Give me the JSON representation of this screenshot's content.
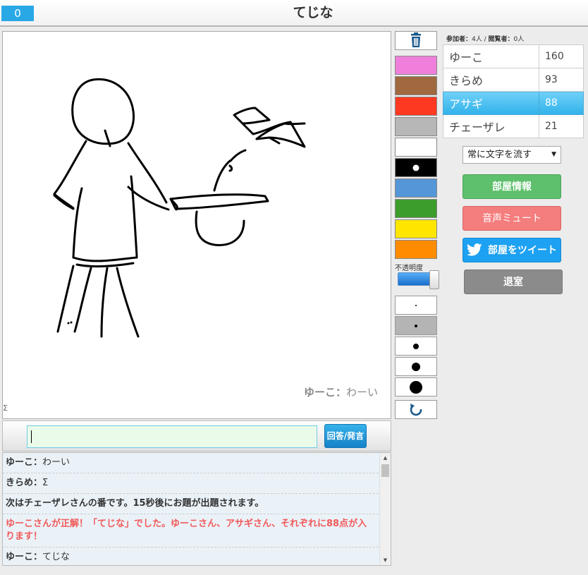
{
  "header": {
    "timer": "0",
    "title": "てじな"
  },
  "canvas": {
    "speech_name": "ゆーこ",
    "speech_sep": "：",
    "speech_text": "わーい",
    "sigma": "Σ"
  },
  "toolbar": {
    "colors": [
      "#f07fdb",
      "#a0693f",
      "#fe3921",
      "#b7b7b7",
      "#ffffff",
      "#000000",
      "#5596d8",
      "#3c9c2c",
      "#ffe600",
      "#ff8b00"
    ],
    "opacity_label": "不透明度",
    "opacity_value": 0.95,
    "brush_sizes": [
      2,
      4,
      8,
      12,
      18
    ],
    "selected_color_index": 5,
    "selected_brush_index": 1
  },
  "participants": {
    "label_participants": "参加者：",
    "participants_count": "4人",
    "sep": " / ",
    "label_viewers": "閲覧者：",
    "viewers_count": "0人"
  },
  "scores": [
    {
      "name": "ゆーこ",
      "points": "160"
    },
    {
      "name": "きらめ",
      "points": "93"
    },
    {
      "name": "アサギ",
      "points": "88"
    },
    {
      "name": "チェーザレ",
      "points": "21"
    }
  ],
  "controls": {
    "scroll_mode": "常に文字を流す",
    "room_info": "部屋情報",
    "mute": "音声ミュート",
    "tweet": "部屋をツイート",
    "leave": "退室"
  },
  "input": {
    "value": "",
    "send_label": "回答/発言"
  },
  "chat": [
    {
      "who": "ゆーこ",
      "sep": "：",
      "text": "わーい"
    },
    {
      "who": "きらめ",
      "sep": "：",
      "text": "Σ"
    },
    {
      "text": "次はチェーザレさんの番です。15秒後にお題が出題されます。"
    },
    {
      "text": "ゆーこさんが正解！「てじな」でした。ゆーこさん、アサギさん、それぞれに88点が入ります！"
    },
    {
      "who": "ゆーこ",
      "sep": "：",
      "text": "てじな"
    }
  ]
}
